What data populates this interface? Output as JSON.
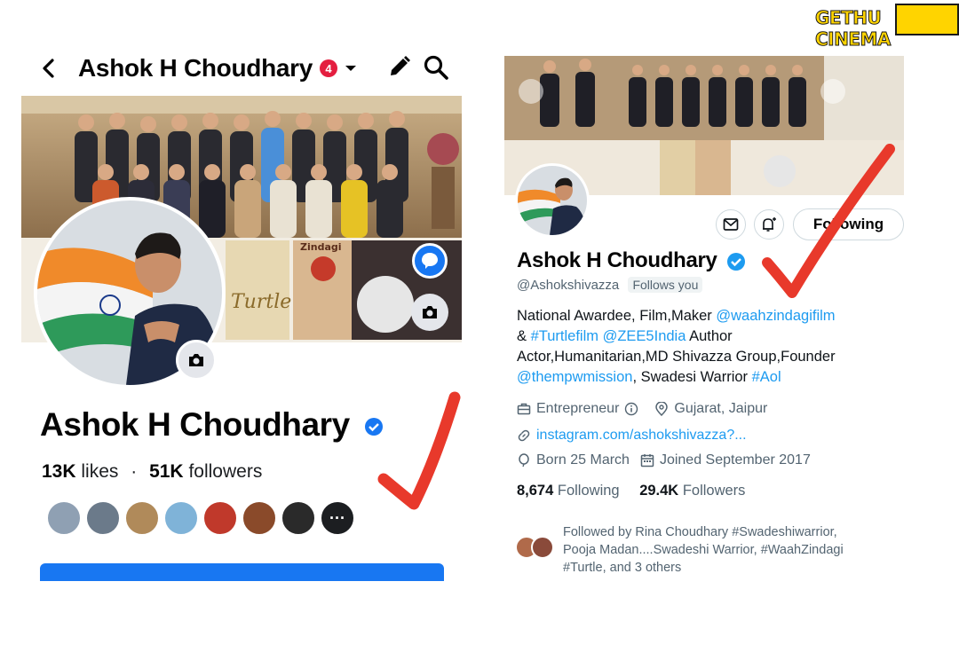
{
  "watermark": {
    "text": "GETHU CINEMA"
  },
  "facebook": {
    "header": {
      "title": "Ashok H Choudhary",
      "badge": "4"
    },
    "profile_name": "Ashok H Choudhary",
    "stats": {
      "likes_count": "13K",
      "likes_label": "likes",
      "separator": "·",
      "followers_count": "51K",
      "followers_label": "followers"
    },
    "friends_more": "···",
    "cover_posters": [
      "Turtle",
      "Zindagi"
    ],
    "icons": [
      "back-arrow-icon",
      "caret-down-icon",
      "pencil-icon",
      "search-icon",
      "camera-icon",
      "verified-icon",
      "messenger-icon"
    ]
  },
  "twitter": {
    "name": "Ashok H Choudhary",
    "handle": "@Ashokshivazza",
    "follows_you": "Follows you",
    "following_button": "Following",
    "bio": {
      "line1_text": "National Awardee, Film,Maker ",
      "line1_link": "@waahzindagifilm",
      "line2_text_a": "& ",
      "line2_link_a": "#Turtlefilm",
      "line2_link_b": "@ZEE5India",
      "line2_text_b": " Author",
      "line3_text": "Actor,Humanitarian,MD Shivazza Group,Founder",
      "line4_link_a": "@thempwmission",
      "line4_text": ", Swadesi Warrior ",
      "line4_link_b": "#Aol"
    },
    "profession": "Entrepreneur",
    "location": "Gujarat, Jaipur",
    "website": "instagram.com/ashokshivazza?...",
    "born": "Born 25 March",
    "joined": "Joined September 2017",
    "following_count": "8,674",
    "following_label": "Following",
    "followers_count": "29.4K",
    "followers_label": "Followers",
    "followed_by": {
      "line1": "Followed by Rina Choudhary #Swadeshiwarrior,",
      "line2": "Pooja Madan....Swadeshi Warrior, #WaahZindagi",
      "line3": "#Turtle, and 3 others"
    },
    "icons": [
      "mail-icon",
      "bell-plus-icon",
      "verified-icon",
      "briefcase-icon",
      "info-icon",
      "location-pin-icon",
      "link-icon",
      "balloon-icon",
      "calendar-icon"
    ]
  },
  "colors": {
    "fb_blue": "#1877f2",
    "tw_blue": "#1d9bf0",
    "check_red": "#e8392b",
    "badge_red": "#e41e3f"
  }
}
